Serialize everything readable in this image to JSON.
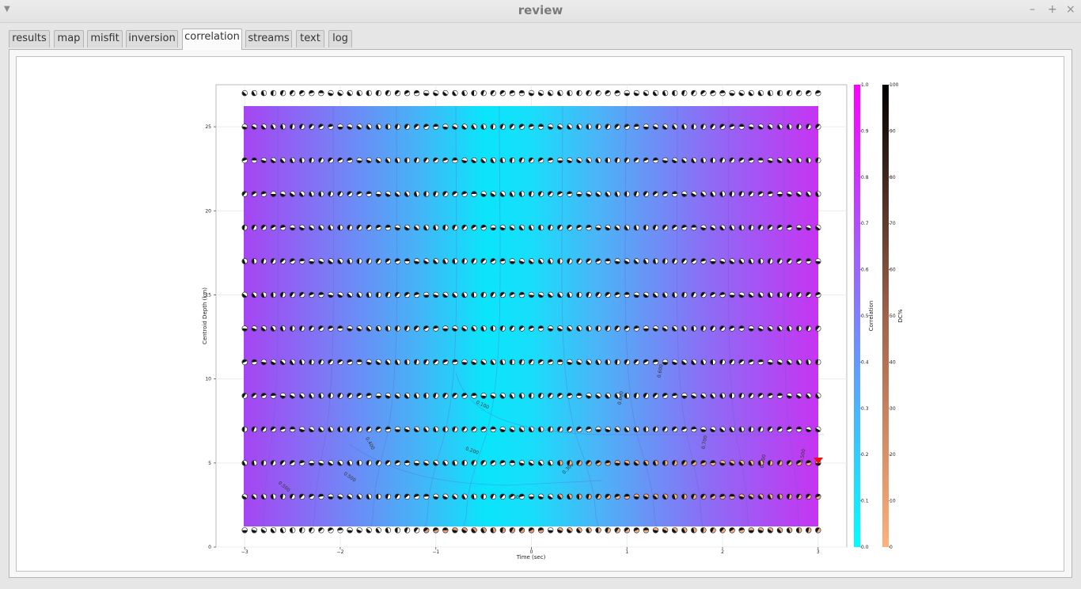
{
  "window": {
    "title": "review",
    "menu_icon": "chevron-down-icon",
    "minimize_glyph": "–",
    "maximize_glyph": "+",
    "close_glyph": "×"
  },
  "tabs": [
    {
      "label": "results",
      "active": false
    },
    {
      "label": "map",
      "active": false
    },
    {
      "label": "misfit",
      "active": false
    },
    {
      "label": "inversion",
      "active": false
    },
    {
      "label": "correlation",
      "active": true
    },
    {
      "label": "streams",
      "active": false
    },
    {
      "label": "text",
      "active": false
    },
    {
      "label": "log",
      "active": false
    }
  ],
  "chart_data": {
    "type": "heatmap",
    "xlabel": "Time (sec)",
    "ylabel": "Centroid Depth (km)",
    "xlim": [
      -3.3,
      3.3
    ],
    "ylim": [
      0,
      27.5
    ],
    "x_ticks": [
      -3,
      -2,
      -1,
      0,
      1,
      2,
      3
    ],
    "x_tick_labels": [
      "−3",
      "−2",
      "−1",
      "0",
      "1",
      "2",
      "3"
    ],
    "y_ticks": [
      0,
      5,
      10,
      15,
      20,
      25
    ],
    "grid_x_range": [
      -3,
      3
    ],
    "grid_x_step": 0.1,
    "grid_depths": [
      1,
      3,
      5,
      7,
      9,
      11,
      13,
      15,
      17,
      19,
      21,
      23,
      25,
      27
    ],
    "contour_labels": [
      "0.100",
      "0.200",
      "0.300",
      "0.300",
      "0.400",
      "0.500",
      "0.500",
      "0.600",
      "0.600",
      "0.700",
      "0.400",
      "0.500"
    ],
    "best_solution": {
      "time": 3.0,
      "depth": 5.0,
      "color": "#e8101a"
    },
    "colorbars": [
      {
        "label": "Correlation",
        "min": 0.0,
        "max": 1.0,
        "tick_labels": [
          "0.0",
          "0.1",
          "0.2",
          "0.3",
          "0.4",
          "0.5",
          "0.6",
          "0.7",
          "0.8",
          "0.9",
          "1.0"
        ],
        "colormap": [
          "#00ffff",
          "#ff00ff"
        ]
      },
      {
        "label": "DC%",
        "min": 0,
        "max": 100,
        "tick_labels": [
          "0",
          "10",
          "20",
          "30",
          "40",
          "50",
          "60",
          "70",
          "80",
          "90",
          "100"
        ],
        "colormap": [
          "#ffb07a",
          "#000000"
        ]
      }
    ],
    "grid": true
  }
}
